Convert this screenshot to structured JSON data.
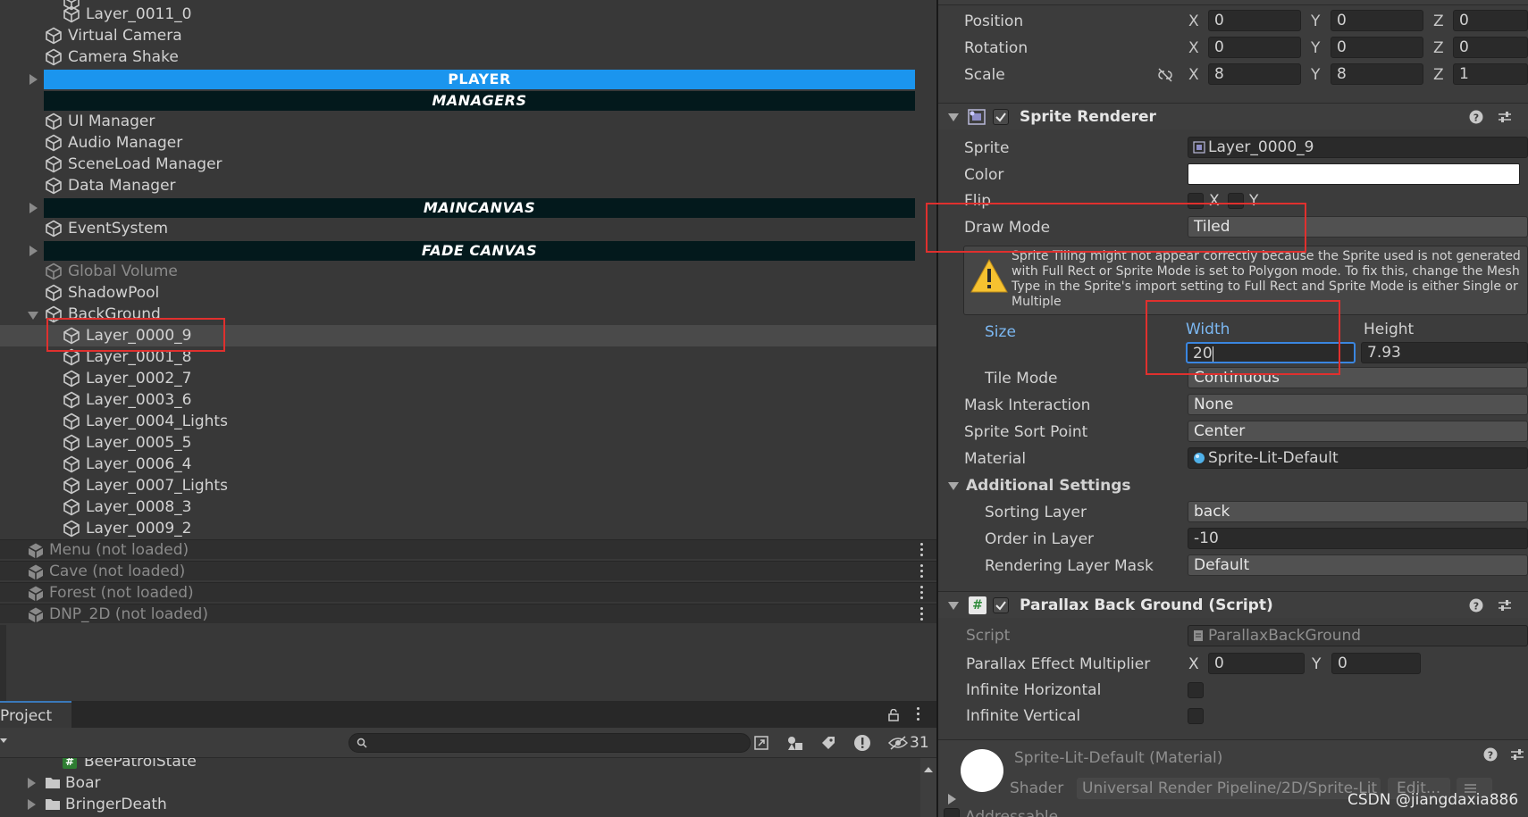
{
  "hierarchy": {
    "items_top": [
      {
        "label": "Layer_0011_0",
        "indent": 2
      },
      {
        "label": "Virtual Camera",
        "indent": 1
      },
      {
        "label": "Camera Shake",
        "indent": 1
      }
    ],
    "headers": [
      {
        "label": "PLAYER",
        "color": "#1b95ee"
      },
      {
        "label": "MANAGERS",
        "color": "#03191c"
      },
      {
        "label": "MAINCANVAS",
        "color": "#03191c"
      },
      {
        "label": "FADE CANVAS",
        "color": "#03191c"
      }
    ],
    "managers": [
      "UI Manager",
      "Audio Manager",
      "SceneLoad Manager",
      "Data Manager"
    ],
    "event_system": "EventSystem",
    "global_volume": "Global Volume",
    "shadow_pool": "ShadowPool",
    "background": "BackGround",
    "layers": [
      "Layer_0000_9",
      "Layer_0001_8",
      "Layer_0002_7",
      "Layer_0003_6",
      "Layer_0004_Lights",
      "Layer_0005_5",
      "Layer_0006_4",
      "Layer_0007_Lights",
      "Layer_0008_3",
      "Layer_0009_2"
    ],
    "scenes": [
      "Menu (not loaded)",
      "Cave (not loaded)",
      "Forest (not loaded)",
      "DNP_2D (not loaded)"
    ]
  },
  "project": {
    "tab": "Project",
    "hidden_count": "31",
    "items": [
      "BeePatrolState",
      "Boar",
      "BringerDeath"
    ]
  },
  "transform": {
    "position": {
      "label": "Position",
      "x": "0",
      "y": "0",
      "z": "0"
    },
    "rotation": {
      "label": "Rotation",
      "x": "0",
      "y": "0",
      "z": "0"
    },
    "scale": {
      "label": "Scale",
      "x": "8",
      "y": "8",
      "z": "1"
    },
    "axis": {
      "x": "X",
      "y": "Y",
      "z": "Z"
    }
  },
  "sprite_renderer": {
    "title": "Sprite Renderer",
    "sprite_label": "Sprite",
    "sprite_value": "Layer_0000_9",
    "color_label": "Color",
    "flip_label": "Flip",
    "flip_x": "X",
    "flip_y": "Y",
    "draw_mode_label": "Draw Mode",
    "draw_mode_value": "Tiled",
    "warning": "Sprite Tiling might not appear correctly because the Sprite used is not generated with Full Rect or Sprite Mode is set to Polygon mode. To fix this, change the Mesh Type in the Sprite's import setting to Full Rect and Sprite Mode is either Single or Multiple",
    "size_label": "Size",
    "width_label": "Width",
    "height_label": "Height",
    "width_value": "20",
    "height_value": "7.93",
    "tile_mode_label": "Tile Mode",
    "tile_mode_value": "Continuous",
    "mask_label": "Mask Interaction",
    "mask_value": "None",
    "sort_point_label": "Sprite Sort Point",
    "sort_point_value": "Center",
    "material_label": "Material",
    "material_value": "Sprite-Lit-Default",
    "additional_label": "Additional Settings",
    "sorting_layer_label": "Sorting Layer",
    "sorting_layer_value": "back",
    "order_label": "Order in Layer",
    "order_value": "-10",
    "render_mask_label": "Rendering Layer Mask",
    "render_mask_value": "Default"
  },
  "parallax": {
    "title": "Parallax Back Ground (Script)",
    "script_label": "Script",
    "script_value": "ParallaxBackGround",
    "multiplier_label": "Parallax Effect Multiplier",
    "mx": "0",
    "my": "0",
    "inf_h_label": "Infinite Horizontal",
    "inf_v_label": "Infinite Vertical"
  },
  "material": {
    "title": "Sprite-Lit-Default (Material)",
    "shader_label": "Shader",
    "shader_value": "Universal Render Pipeline/2D/Sprite-Lit",
    "edit_label": "Edit...",
    "addressable": "Addressable"
  },
  "watermark": "CSDN @jiangdaxia886"
}
